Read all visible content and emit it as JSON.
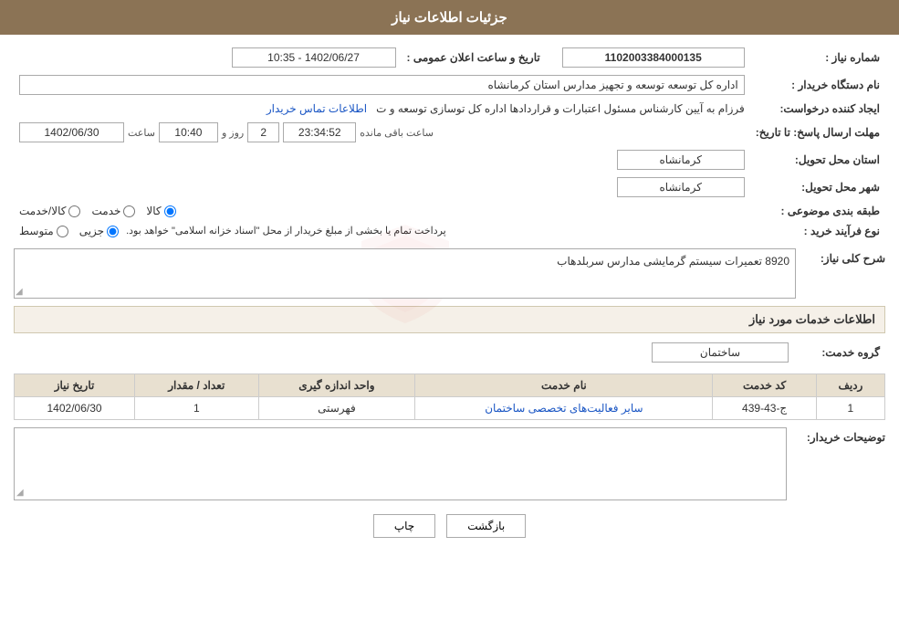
{
  "header": {
    "title": "جزئیات اطلاعات نیاز"
  },
  "fields": {
    "need_number_label": "شماره نیاز :",
    "need_number_value": "1102003384000135",
    "announce_datetime_label": "تاریخ و ساعت اعلان عمومی :",
    "announce_datetime_value": "1402/06/27 - 10:35",
    "buyer_org_label": "نام دستگاه خریدار :",
    "buyer_org_value": "اداره کل توسعه  توسعه و تجهیز مدارس استان کرمانشاه",
    "creator_label": "ایجاد کننده درخواست:",
    "creator_value": "فرزام به آیین کارشناس مسئول اعتبارات و قراردادها اداره کل توسازی  توسعه و ت",
    "creator_link": "اطلاعات تماس خریدار",
    "deadline_label": "مهلت ارسال پاسخ: تا تاریخ:",
    "deadline_date": "1402/06/30",
    "deadline_time_label": "ساعت",
    "deadline_time": "10:40",
    "deadline_days_label": "روز و",
    "deadline_days": "2",
    "deadline_remaining_label": "ساعت باقی مانده",
    "deadline_remaining": "23:34:52",
    "province_label": "استان محل تحویل:",
    "province_value": "کرمانشاه",
    "city_label": "شهر محل تحویل:",
    "city_value": "کرمانشاه",
    "category_label": "طبقه بندی موضوعی :",
    "category_options": [
      "کالا",
      "خدمت",
      "کالا/خدمت"
    ],
    "category_selected": "کالا",
    "purchase_type_label": "نوع فرآیند خرید :",
    "purchase_type_options": [
      "جزیی",
      "متوسط"
    ],
    "purchase_type_note": "پرداخت تمام یا بخشی از مبلغ خریدار از محل \"اسناد خزانه اسلامی\" خواهد بود.",
    "need_desc_label": "شرح کلی نیاز:",
    "need_desc_value": "8920 تعمیرات سیستم گرمایشی مدارس سربلدهاب",
    "services_section_label": "اطلاعات خدمات مورد نیاز",
    "service_group_label": "گروه خدمت:",
    "service_group_value": "ساختمان",
    "table": {
      "headers": [
        "ردیف",
        "کد خدمت",
        "نام خدمت",
        "واحد اندازه گیری",
        "تعداد / مقدار",
        "تاریخ نیاز"
      ],
      "rows": [
        {
          "row": "1",
          "code": "ج-43-439",
          "name": "سایر فعالیت‌های تخصصی ساختمان",
          "unit": "فهرستی",
          "quantity": "1",
          "date": "1402/06/30"
        }
      ]
    },
    "buyer_notes_label": "توضیحات خریدار:",
    "buyer_notes_value": ""
  },
  "buttons": {
    "print_label": "چاپ",
    "back_label": "بازگشت"
  }
}
